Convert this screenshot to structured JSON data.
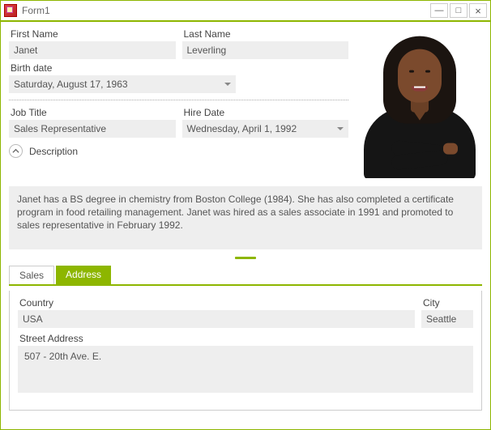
{
  "window": {
    "title": "Form1",
    "buttons": {
      "min": "—",
      "max": "□",
      "close": "×"
    }
  },
  "person": {
    "first_name_label": "First Name",
    "first_name": "Janet",
    "last_name_label": "Last Name",
    "last_name": "Leverling",
    "birth_date_label": "Birth date",
    "birth_date": "Saturday, August 17, 1963",
    "job_title_label": "Job Title",
    "job_title": "Sales Representative",
    "hire_date_label": "Hire Date",
    "hire_date": "Wednesday, April 1, 1992",
    "description_label": "Description",
    "description": "Janet has a BS degree in chemistry from Boston College (1984). She has also completed a certificate program in food retailing management. Janet was hired as a sales associate in 1991 and promoted to sales representative in February 1992."
  },
  "tabs": {
    "sales": "Sales",
    "address": "Address",
    "active": "address"
  },
  "address": {
    "country_label": "Country",
    "country": "USA",
    "city_label": "City",
    "city": "Seattle",
    "street_label": "Street Address",
    "street": "507 - 20th Ave. E."
  }
}
